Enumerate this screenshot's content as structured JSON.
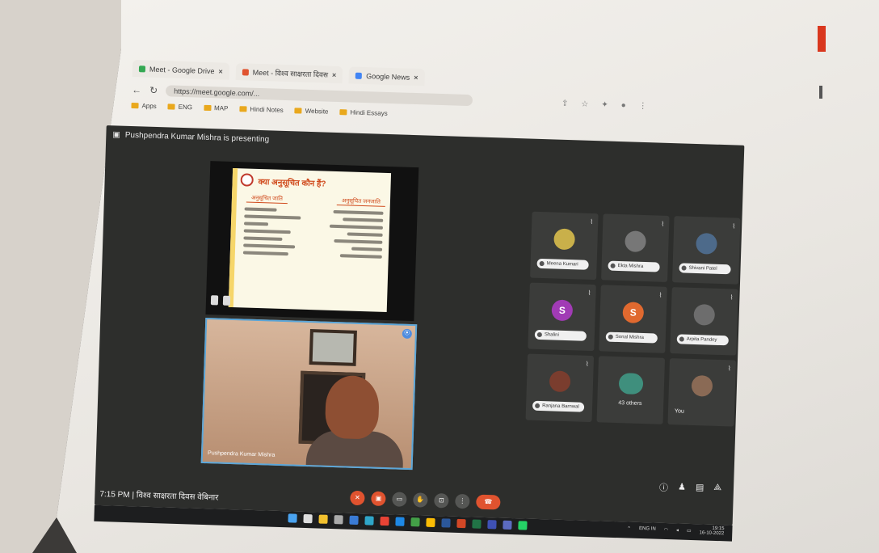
{
  "browser": {
    "tabs": [
      {
        "label": "Meet - Google Drive",
        "color": "#34a853"
      },
      {
        "label": "Meet - विश्व साक्षरता दिवस",
        "color": "#e0532f"
      },
      {
        "label": "Google News",
        "color": "#4285f4"
      }
    ],
    "url": "https://meet.google.com/...",
    "bookmarks": [
      "Apps",
      "ENG",
      "MAP",
      "Hindi Notes",
      "Website",
      "Hindi Essays"
    ]
  },
  "meet": {
    "presenting_text": "Pushpendra Kumar Mishra is presenting",
    "slide": {
      "title": "क्या अनुसूचित कौन हैं?",
      "col_left": "अनुसूचित जाति",
      "col_right": "अनुसूचित जनजाति"
    },
    "camera_name": "Pushpendra Kumar Mishra",
    "participants": [
      {
        "name": "Meena Kumari",
        "avatar_color": "#c9b04a",
        "initial": ""
      },
      {
        "name": "Ekta Mishra",
        "avatar_color": "#777",
        "initial": ""
      },
      {
        "name": "Shivani Patel",
        "avatar_color": "#4d6a8a",
        "initial": ""
      },
      {
        "name": "Shalini",
        "avatar_color": "#a13bb5",
        "initial": "S"
      },
      {
        "name": "Sonal Mishra",
        "avatar_color": "#e0692f",
        "initial": "S"
      },
      {
        "name": "Arpita Pandey",
        "avatar_color": "#6d6d6d",
        "initial": ""
      },
      {
        "name": "Ranjana Barnwal",
        "avatar_color": "#7a3d2e",
        "initial": ""
      }
    ],
    "others_count": "43 others",
    "you_label": "You",
    "time": "7:15 PM",
    "meeting_title": "विश्व साक्षरता दिवस वेबिनार"
  },
  "taskbar": {
    "lang": "ENG IN",
    "clock_time": "19:15",
    "clock_date": "16-10-2022"
  }
}
